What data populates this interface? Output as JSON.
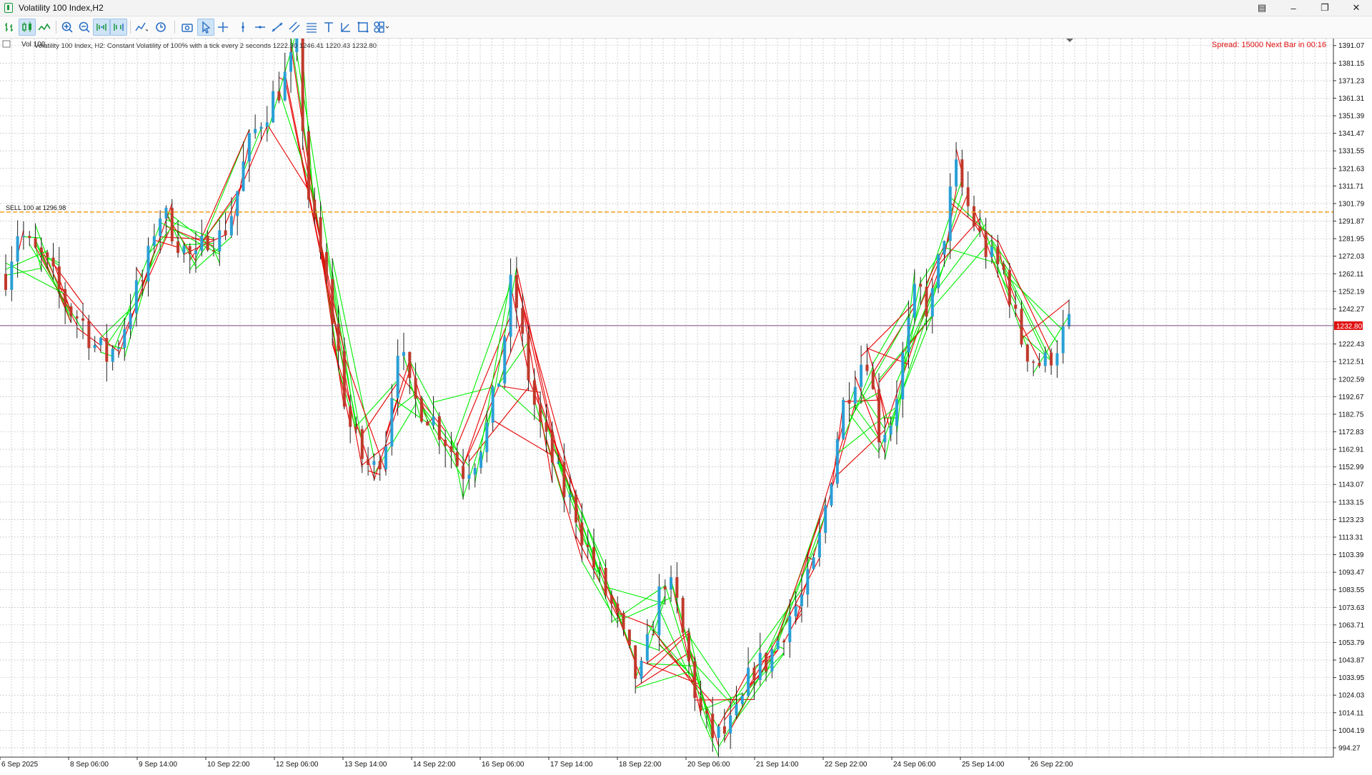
{
  "window": {
    "title": "Volatility 100 Index,H2"
  },
  "toolbar": {
    "icons": [
      "bar-chart-icon",
      "candlestick-icon",
      "line-chart-icon",
      "zoom-in-icon",
      "zoom-out-icon",
      "chart-shift-icon",
      "autoscroll-icon",
      "indicators-icon",
      "timeframe-icon",
      "screenshot-icon",
      "cursor-icon",
      "crosshair-icon",
      "vertical-line-icon",
      "horizontal-line-icon",
      "trendline-icon",
      "channel-icon",
      "fibonacci-icon",
      "text-icon",
      "arrow-icon",
      "rectangle-icon",
      "shapes-icon"
    ]
  },
  "chart": {
    "symbol_label": "Volatility 100 Index, H2:  Constant Volatility of 100% with a tick every 2 seconds  1222.30 1246.41 1220.43 1232.80",
    "overlay_tag": "Vol 100",
    "spread_text": "Spread: 15000 Next Bar in 00:16",
    "sell_label": "SELL 100 at 1296.98",
    "current_price": "1232.80",
    "colors": {
      "bull": "#2a9fd6",
      "bear": "#c0392b",
      "wick": "#222222",
      "green_lines": "#00ee00",
      "red_lines": "#e60000",
      "sell_line": "#f0a020",
      "price_line": "#7a4a7a",
      "price_tag": "#e01010",
      "spread_text": "#e01010"
    }
  },
  "chart_data": {
    "type": "candlestick",
    "timeframe": "H2",
    "ylim": [
      989,
      1395
    ],
    "y_ticks": [
      "1391.07",
      "1381.15",
      "1371.23",
      "1361.31",
      "1351.39",
      "1341.47",
      "1331.55",
      "1321.63",
      "1311.71",
      "1301.79",
      "1291.87",
      "1281.95",
      "1272.03",
      "1262.11",
      "1252.19",
      "1242.27",
      "1222.43",
      "1212.51",
      "1202.59",
      "1192.67",
      "1182.75",
      "1172.83",
      "1162.91",
      "1152.99",
      "1143.07",
      "1133.15",
      "1123.23",
      "1113.31",
      "1103.39",
      "1093.47",
      "1083.55",
      "1073.63",
      "1063.71",
      "1053.79",
      "1043.87",
      "1033.95",
      "1024.03",
      "1014.11",
      "1004.19",
      "994.27"
    ],
    "x_labels": [
      "6 Sep 2025",
      "8 Sep 06:00",
      "9 Sep 14:00",
      "10 Sep 22:00",
      "12 Sep 06:00",
      "13 Sep 14:00",
      "14 Sep 22:00",
      "16 Sep 06:00",
      "17 Sep 14:00",
      "18 Sep 22:00",
      "20 Sep 06:00",
      "21 Sep 14:00",
      "22 Sep 22:00",
      "24 Sep 06:00",
      "25 Sep 14:00",
      "26 Sep 22:00"
    ],
    "price_path": [
      1262,
      1288,
      1275,
      1270,
      1255,
      1242,
      1236,
      1222,
      1215,
      1225,
      1248,
      1260,
      1298,
      1290,
      1276,
      1268,
      1285,
      1282,
      1300,
      1330,
      1348,
      1360,
      1372,
      1388,
      1300,
      1268,
      1230,
      1180,
      1160,
      1150,
      1168,
      1225,
      1192,
      1186,
      1178,
      1166,
      1150,
      1158,
      1175,
      1205,
      1260,
      1215,
      1180,
      1160,
      1140,
      1128,
      1105,
      1088,
      1072,
      1050,
      1030,
      1060,
      1092,
      1075,
      1040,
      1010,
      1000,
      1003,
      1015,
      1040,
      1042,
      1055,
      1070,
      1080,
      1100,
      1140,
      1185,
      1205,
      1218,
      1172,
      1180,
      1220,
      1255,
      1240,
      1280,
      1322,
      1300,
      1282,
      1268,
      1262,
      1228,
      1215,
      1210,
      1222,
      1232.8
    ],
    "sell_level": 1296.98,
    "current_price": 1232.8
  }
}
